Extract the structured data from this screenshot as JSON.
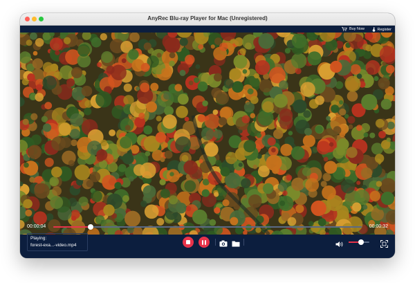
{
  "window": {
    "title": "AnyRec Blu-ray Player for Mac (Unregistered)"
  },
  "toolbar": {
    "buy_now": "Buy Now",
    "register": "Register"
  },
  "playback": {
    "current_time": "00:00:04",
    "total_time": "00:00:32",
    "progress_fraction": 0.12,
    "volume_fraction": 0.6
  },
  "now_playing": {
    "label": "Playing:",
    "file": "forest-exa...-video.mp4"
  },
  "colors": {
    "accent": "#e8334a",
    "chrome": "#0c1e3e"
  },
  "icons": [
    "cart-icon",
    "key-icon",
    "stop-icon",
    "pause-icon",
    "camera-icon",
    "folder-icon",
    "volume-icon",
    "fullscreen-icon"
  ]
}
